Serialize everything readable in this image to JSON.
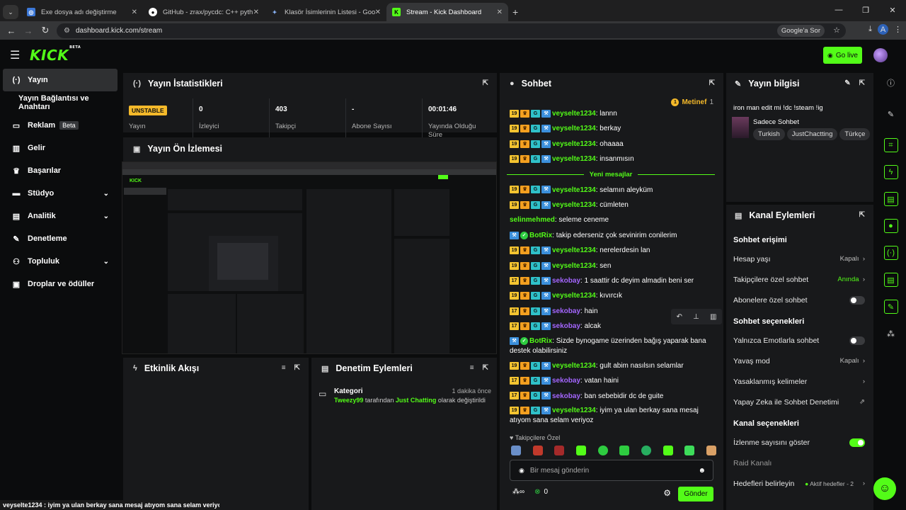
{
  "browser": {
    "tabs": [
      {
        "title": "Exe dosya adı değiştirme",
        "active": false
      },
      {
        "title": "GitHub - zrax/pycdc: C++ pyth",
        "active": false
      },
      {
        "title": "Klasör İsimlerinin Listesi - Goo",
        "active": false
      },
      {
        "title": "Stream - Kick Dashboard",
        "active": true
      }
    ],
    "url": "dashboard.kick.com/stream",
    "google_btn": "Google'a Sor",
    "profile_initial": "A"
  },
  "topbar": {
    "logo": "KICK",
    "logo_sup": "BETA",
    "go_live": "Go live"
  },
  "sidebar": {
    "items": [
      {
        "label": "Yayın",
        "icon": "broadcast-icon"
      },
      {
        "label": "Yayın Bağlantısı ve Anahtarı"
      },
      {
        "label": "Reklam",
        "badge": "Beta",
        "icon": "ad-icon"
      },
      {
        "label": "Gelir",
        "icon": "chart-icon"
      },
      {
        "label": "Başarılar",
        "icon": "trophy-icon"
      },
      {
        "label": "Stüdyo",
        "icon": "studio-icon"
      },
      {
        "label": "Analitik",
        "icon": "analytics-icon"
      },
      {
        "label": "Denetleme",
        "icon": "wrench-icon"
      },
      {
        "label": "Topluluk",
        "icon": "community-icon"
      },
      {
        "label": "Droplar ve ödüller",
        "icon": "gift-icon"
      }
    ]
  },
  "stats": {
    "title": "Yayın İstatistikleri",
    "status": "UNSTABLE",
    "status_label": "Yayın",
    "items": [
      {
        "value": "0",
        "label": "İzleyici"
      },
      {
        "value": "403",
        "label": "Takipçi"
      },
      {
        "value": "-",
        "label": "Abone Sayısı"
      },
      {
        "value": "00:01:46",
        "label": "Yayında Olduğu Süre"
      }
    ]
  },
  "preview": {
    "title": "Yayın Ön İzlemesi"
  },
  "activity": {
    "title": "Etkinlik Akışı"
  },
  "moderation": {
    "title": "Denetim Eylemleri",
    "entry_title": "Kategori",
    "entry_time": "1 dakika önce",
    "entry_user": "Tweezy99",
    "entry_mid": " tarafından ",
    "entry_cat": "Just Chatting",
    "entry_end": " olarak değiştirildi"
  },
  "chat": {
    "title": "Sohbet",
    "pinned": "Metinef",
    "pinned_count": "1",
    "new_messages": "Yeni mesajlar",
    "followers_only": "Takipçilere Özel",
    "placeholder": "Bir mesaj gönderin",
    "points": "0",
    "send": "Gönder",
    "messages_before": [
      {
        "badge": "19",
        "user": "veyselte1234",
        "color": "g",
        "text": "lannn"
      },
      {
        "badge": "19",
        "user": "veyselte1234",
        "color": "g",
        "text": "berkay"
      },
      {
        "badge": "19",
        "user": "veyselte1234",
        "color": "g",
        "text": "ohaaaa"
      },
      {
        "badge": "19",
        "user": "veyselte1234",
        "color": "g",
        "text": "insanmısın"
      }
    ],
    "messages_after": [
      {
        "badge": "19",
        "user": "veyselte1234",
        "color": "g",
        "text": "selamın aleyküm"
      },
      {
        "badge": "19",
        "user": "veyselte1234",
        "color": "g",
        "text": "cümleten"
      },
      {
        "badge": "",
        "user": "selinmehmed",
        "color": "g",
        "text": "seleme ceneme"
      },
      {
        "badge": "bot",
        "user": "BotRix",
        "color": "g",
        "text": "takip ederseniz çok sevinirim conilerim"
      },
      {
        "badge": "19",
        "user": "veyselte1234",
        "color": "g",
        "text": "nerelerdesin lan"
      },
      {
        "badge": "19",
        "user": "veyselte1234",
        "color": "g",
        "text": "sen"
      },
      {
        "badge": "17",
        "user": "sekobay",
        "color": "p",
        "text": "1 saattir dc deyim almadin beni ser"
      },
      {
        "badge": "19",
        "user": "veyselte1234",
        "color": "g",
        "text": "kıvırcık"
      },
      {
        "badge": "17",
        "user": "sekobay",
        "color": "p",
        "text": "hain"
      },
      {
        "badge": "17",
        "user": "sekobay",
        "color": "p",
        "text": "alcak"
      },
      {
        "badge": "bot",
        "user": "BotRix",
        "color": "g",
        "text": "Sizde bynogame üzerinden bağış yaparak bana destek olabilirsiniz",
        "wrap": true
      },
      {
        "badge": "19",
        "user": "veyselte1234",
        "color": "g",
        "text": "gult abim nasılsın selamlar"
      },
      {
        "badge": "17",
        "user": "sekobay",
        "color": "p",
        "text": "vatan haini"
      },
      {
        "badge": "17",
        "user": "sekobay",
        "color": "p",
        "text": "ban sebebidir dc de guite"
      },
      {
        "badge": "19",
        "user": "veyselte1234",
        "color": "g",
        "text": "iyim ya ulan berkay sana mesaj atıyom sana selam veriyoz",
        "wrap": true
      }
    ]
  },
  "stream_info": {
    "title": "Yayın bilgisi",
    "stream_title": "iron man edit mi !dc !steam !ig",
    "category": "Sadece Sohbet",
    "tags": [
      "Turkish",
      "JustChactting",
      "Türkçe"
    ]
  },
  "channel_actions": {
    "title": "Kanal Eylemleri",
    "chat_access": "Sohbet erişimi",
    "account_age": "Hesap yaşı",
    "account_age_val": "Kapalı",
    "follower_chat": "Takipçilere özel sohbet",
    "follower_chat_val": "Anında",
    "sub_chat": "Abonelere özel sohbet",
    "chat_options": "Sohbet seçenekleri",
    "emote_only": "Yalnızca Emotlarla sohbet",
    "slow_mode": "Yavaş mod",
    "slow_mode_val": "Kapalı",
    "banned_words": "Yasaklanmış kelimeler",
    "ai_mod": "Yapay Zeka ile Sohbet Denetimi",
    "channel_options": "Kanal seçenekleri",
    "show_viewers": "İzlenme sayısını göster",
    "raid": "Raid Kanalı",
    "goals": "Hedefleri belirleyin",
    "goals_val": "Aktif hedefler - 2"
  },
  "status_bar": "veyselte1234 : iyim ya ulan berkay sana mesaj atıyom sana selam veriyoz",
  "colors": {
    "accent": "#53fc18",
    "unstable": "#f4b92a",
    "purple": "#a466ff",
    "panel": "#18191b"
  }
}
